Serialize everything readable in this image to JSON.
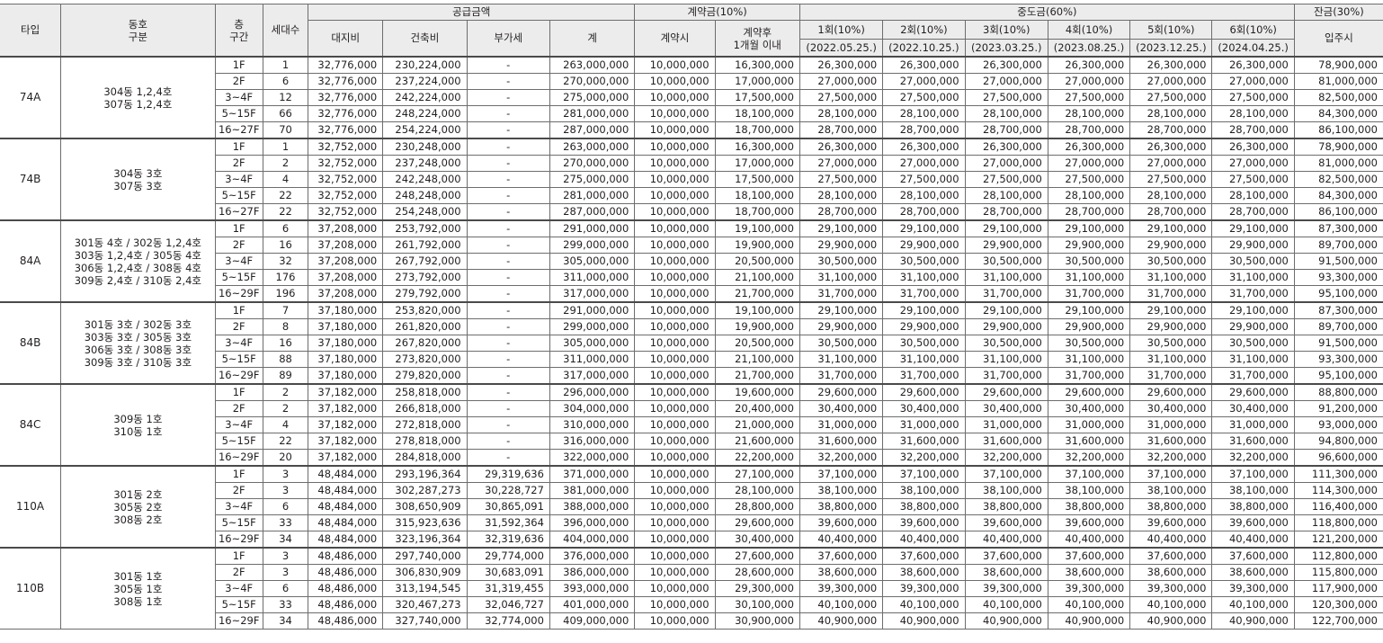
{
  "headers": {
    "type": "타입",
    "dong_l1": "동호",
    "dong_l2": "구분",
    "floor_l1": "층",
    "floor_l2": "구간",
    "households": "세대수",
    "supply": "공급금액",
    "land": "대지비",
    "building": "건축비",
    "vat": "부가세",
    "total": "계",
    "deposit": "계약금(10%)",
    "deposit_at_contract": "계약시",
    "deposit_after_l1": "계약후",
    "deposit_after_l2": "1개월 이내",
    "middle": "중도금(60%)",
    "installments": [
      {
        "label": "1회(10%)",
        "date": "(2022.05.25.)"
      },
      {
        "label": "2회(10%)",
        "date": "(2022.10.25.)"
      },
      {
        "label": "3회(10%)",
        "date": "(2023.03.25.)"
      },
      {
        "label": "4회(10%)",
        "date": "(2023.08.25.)"
      },
      {
        "label": "5회(10%)",
        "date": "(2023.12.25.)"
      },
      {
        "label": "6회(10%)",
        "date": "(2024.04.25.)"
      }
    ],
    "balance": "잔금(30%)",
    "balance_sub": "입주시"
  },
  "groups": [
    {
      "type": "74A",
      "dong": [
        "304동 1,2,4호",
        "307동 1,2,4호"
      ],
      "rows": [
        {
          "floor": "1F",
          "units": "1",
          "land": "32,776,000",
          "building": "230,224,000",
          "vat": "-",
          "total": "263,000,000",
          "dep1": "10,000,000",
          "dep2": "16,300,000",
          "mid": "26,300,000",
          "bal": "78,900,000"
        },
        {
          "floor": "2F",
          "units": "6",
          "land": "32,776,000",
          "building": "237,224,000",
          "vat": "-",
          "total": "270,000,000",
          "dep1": "10,000,000",
          "dep2": "17,000,000",
          "mid": "27,000,000",
          "bal": "81,000,000"
        },
        {
          "floor": "3~4F",
          "units": "12",
          "land": "32,776,000",
          "building": "242,224,000",
          "vat": "-",
          "total": "275,000,000",
          "dep1": "10,000,000",
          "dep2": "17,500,000",
          "mid": "27,500,000",
          "bal": "82,500,000"
        },
        {
          "floor": "5~15F",
          "units": "66",
          "land": "32,776,000",
          "building": "248,224,000",
          "vat": "-",
          "total": "281,000,000",
          "dep1": "10,000,000",
          "dep2": "18,100,000",
          "mid": "28,100,000",
          "bal": "84,300,000"
        },
        {
          "floor": "16~27F",
          "units": "70",
          "land": "32,776,000",
          "building": "254,224,000",
          "vat": "-",
          "total": "287,000,000",
          "dep1": "10,000,000",
          "dep2": "18,700,000",
          "mid": "28,700,000",
          "bal": "86,100,000"
        }
      ]
    },
    {
      "type": "74B",
      "dong": [
        "304동 3호",
        "307동 3호"
      ],
      "rows": [
        {
          "floor": "1F",
          "units": "1",
          "land": "32,752,000",
          "building": "230,248,000",
          "vat": "-",
          "total": "263,000,000",
          "dep1": "10,000,000",
          "dep2": "16,300,000",
          "mid": "26,300,000",
          "bal": "78,900,000"
        },
        {
          "floor": "2F",
          "units": "2",
          "land": "32,752,000",
          "building": "237,248,000",
          "vat": "-",
          "total": "270,000,000",
          "dep1": "10,000,000",
          "dep2": "17,000,000",
          "mid": "27,000,000",
          "bal": "81,000,000"
        },
        {
          "floor": "3~4F",
          "units": "4",
          "land": "32,752,000",
          "building": "242,248,000",
          "vat": "-",
          "total": "275,000,000",
          "dep1": "10,000,000",
          "dep2": "17,500,000",
          "mid": "27,500,000",
          "bal": "82,500,000"
        },
        {
          "floor": "5~15F",
          "units": "22",
          "land": "32,752,000",
          "building": "248,248,000",
          "vat": "-",
          "total": "281,000,000",
          "dep1": "10,000,000",
          "dep2": "18,100,000",
          "mid": "28,100,000",
          "bal": "84,300,000"
        },
        {
          "floor": "16~27F",
          "units": "22",
          "land": "32,752,000",
          "building": "254,248,000",
          "vat": "-",
          "total": "287,000,000",
          "dep1": "10,000,000",
          "dep2": "18,700,000",
          "mid": "28,700,000",
          "bal": "86,100,000"
        }
      ]
    },
    {
      "type": "84A",
      "dong": [
        "301동 4호 / 302동 1,2,4호",
        "303동 1,2,4호 / 305동 4호",
        "306동 1,2,4호 / 308동 4호",
        "309동 2,4호 / 310동 2,4호"
      ],
      "rows": [
        {
          "floor": "1F",
          "units": "6",
          "land": "37,208,000",
          "building": "253,792,000",
          "vat": "-",
          "total": "291,000,000",
          "dep1": "10,000,000",
          "dep2": "19,100,000",
          "mid": "29,100,000",
          "bal": "87,300,000"
        },
        {
          "floor": "2F",
          "units": "16",
          "land": "37,208,000",
          "building": "261,792,000",
          "vat": "-",
          "total": "299,000,000",
          "dep1": "10,000,000",
          "dep2": "19,900,000",
          "mid": "29,900,000",
          "bal": "89,700,000"
        },
        {
          "floor": "3~4F",
          "units": "32",
          "land": "37,208,000",
          "building": "267,792,000",
          "vat": "-",
          "total": "305,000,000",
          "dep1": "10,000,000",
          "dep2": "20,500,000",
          "mid": "30,500,000",
          "bal": "91,500,000"
        },
        {
          "floor": "5~15F",
          "units": "176",
          "land": "37,208,000",
          "building": "273,792,000",
          "vat": "-",
          "total": "311,000,000",
          "dep1": "10,000,000",
          "dep2": "21,100,000",
          "mid": "31,100,000",
          "bal": "93,300,000"
        },
        {
          "floor": "16~29F",
          "units": "196",
          "land": "37,208,000",
          "building": "279,792,000",
          "vat": "-",
          "total": "317,000,000",
          "dep1": "10,000,000",
          "dep2": "21,700,000",
          "mid": "31,700,000",
          "bal": "95,100,000"
        }
      ]
    },
    {
      "type": "84B",
      "dong": [
        "301동 3호 / 302동 3호",
        "303동 3호 / 305동 3호",
        "306동 3호 / 308동 3호",
        "309동 3호 / 310동 3호"
      ],
      "rows": [
        {
          "floor": "1F",
          "units": "7",
          "land": "37,180,000",
          "building": "253,820,000",
          "vat": "-",
          "total": "291,000,000",
          "dep1": "10,000,000",
          "dep2": "19,100,000",
          "mid": "29,100,000",
          "bal": "87,300,000"
        },
        {
          "floor": "2F",
          "units": "8",
          "land": "37,180,000",
          "building": "261,820,000",
          "vat": "-",
          "total": "299,000,000",
          "dep1": "10,000,000",
          "dep2": "19,900,000",
          "mid": "29,900,000",
          "bal": "89,700,000"
        },
        {
          "floor": "3~4F",
          "units": "16",
          "land": "37,180,000",
          "building": "267,820,000",
          "vat": "-",
          "total": "305,000,000",
          "dep1": "10,000,000",
          "dep2": "20,500,000",
          "mid": "30,500,000",
          "bal": "91,500,000"
        },
        {
          "floor": "5~15F",
          "units": "88",
          "land": "37,180,000",
          "building": "273,820,000",
          "vat": "-",
          "total": "311,000,000",
          "dep1": "10,000,000",
          "dep2": "21,100,000",
          "mid": "31,100,000",
          "bal": "93,300,000"
        },
        {
          "floor": "16~29F",
          "units": "89",
          "land": "37,180,000",
          "building": "279,820,000",
          "vat": "-",
          "total": "317,000,000",
          "dep1": "10,000,000",
          "dep2": "21,700,000",
          "mid": "31,700,000",
          "bal": "95,100,000"
        }
      ]
    },
    {
      "type": "84C",
      "dong": [
        "309동 1호",
        "310동 1호"
      ],
      "rows": [
        {
          "floor": "1F",
          "units": "2",
          "land": "37,182,000",
          "building": "258,818,000",
          "vat": "-",
          "total": "296,000,000",
          "dep1": "10,000,000",
          "dep2": "19,600,000",
          "mid": "29,600,000",
          "bal": "88,800,000"
        },
        {
          "floor": "2F",
          "units": "2",
          "land": "37,182,000",
          "building": "266,818,000",
          "vat": "-",
          "total": "304,000,000",
          "dep1": "10,000,000",
          "dep2": "20,400,000",
          "mid": "30,400,000",
          "bal": "91,200,000"
        },
        {
          "floor": "3~4F",
          "units": "4",
          "land": "37,182,000",
          "building": "272,818,000",
          "vat": "-",
          "total": "310,000,000",
          "dep1": "10,000,000",
          "dep2": "21,000,000",
          "mid": "31,000,000",
          "bal": "93,000,000"
        },
        {
          "floor": "5~15F",
          "units": "22",
          "land": "37,182,000",
          "building": "278,818,000",
          "vat": "-",
          "total": "316,000,000",
          "dep1": "10,000,000",
          "dep2": "21,600,000",
          "mid": "31,600,000",
          "bal": "94,800,000"
        },
        {
          "floor": "16~29F",
          "units": "20",
          "land": "37,182,000",
          "building": "284,818,000",
          "vat": "-",
          "total": "322,000,000",
          "dep1": "10,000,000",
          "dep2": "22,200,000",
          "mid": "32,200,000",
          "bal": "96,600,000"
        }
      ]
    },
    {
      "type": "110A",
      "dong": [
        "301동 2호",
        "305동 2호",
        "308동 2호"
      ],
      "rows": [
        {
          "floor": "1F",
          "units": "3",
          "land": "48,484,000",
          "building": "293,196,364",
          "vat": "29,319,636",
          "total": "371,000,000",
          "dep1": "10,000,000",
          "dep2": "27,100,000",
          "mid": "37,100,000",
          "bal": "111,300,000"
        },
        {
          "floor": "2F",
          "units": "3",
          "land": "48,484,000",
          "building": "302,287,273",
          "vat": "30,228,727",
          "total": "381,000,000",
          "dep1": "10,000,000",
          "dep2": "28,100,000",
          "mid": "38,100,000",
          "bal": "114,300,000"
        },
        {
          "floor": "3~4F",
          "units": "6",
          "land": "48,484,000",
          "building": "308,650,909",
          "vat": "30,865,091",
          "total": "388,000,000",
          "dep1": "10,000,000",
          "dep2": "28,800,000",
          "mid": "38,800,000",
          "bal": "116,400,000"
        },
        {
          "floor": "5~15F",
          "units": "33",
          "land": "48,484,000",
          "building": "315,923,636",
          "vat": "31,592,364",
          "total": "396,000,000",
          "dep1": "10,000,000",
          "dep2": "29,600,000",
          "mid": "39,600,000",
          "bal": "118,800,000"
        },
        {
          "floor": "16~29F",
          "units": "34",
          "land": "48,484,000",
          "building": "323,196,364",
          "vat": "32,319,636",
          "total": "404,000,000",
          "dep1": "10,000,000",
          "dep2": "30,400,000",
          "mid": "40,400,000",
          "bal": "121,200,000"
        }
      ]
    },
    {
      "type": "110B",
      "dong": [
        "301동 1호",
        "305동 1호",
        "308동 1호"
      ],
      "rows": [
        {
          "floor": "1F",
          "units": "3",
          "land": "48,486,000",
          "building": "297,740,000",
          "vat": "29,774,000",
          "total": "376,000,000",
          "dep1": "10,000,000",
          "dep2": "27,600,000",
          "mid": "37,600,000",
          "bal": "112,800,000"
        },
        {
          "floor": "2F",
          "units": "3",
          "land": "48,486,000",
          "building": "306,830,909",
          "vat": "30,683,091",
          "total": "386,000,000",
          "dep1": "10,000,000",
          "dep2": "28,600,000",
          "mid": "38,600,000",
          "bal": "115,800,000"
        },
        {
          "floor": "3~4F",
          "units": "6",
          "land": "48,486,000",
          "building": "313,194,545",
          "vat": "31,319,455",
          "total": "393,000,000",
          "dep1": "10,000,000",
          "dep2": "29,300,000",
          "mid": "39,300,000",
          "bal": "117,900,000"
        },
        {
          "floor": "5~15F",
          "units": "33",
          "land": "48,486,000",
          "building": "320,467,273",
          "vat": "32,046,727",
          "total": "401,000,000",
          "dep1": "10,000,000",
          "dep2": "30,100,000",
          "mid": "40,100,000",
          "bal": "120,300,000"
        },
        {
          "floor": "16~29F",
          "units": "34",
          "land": "48,486,000",
          "building": "327,740,000",
          "vat": "32,774,000",
          "total": "409,000,000",
          "dep1": "10,000,000",
          "dep2": "30,900,000",
          "mid": "40,900,000",
          "bal": "122,700,000"
        }
      ]
    }
  ]
}
